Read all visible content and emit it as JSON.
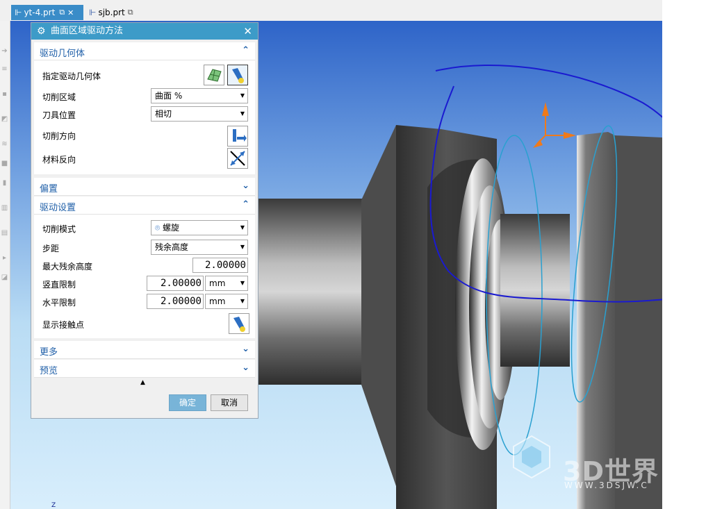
{
  "tabs": [
    {
      "label": "yt-4.prt",
      "active": true
    },
    {
      "label": "sjb.prt",
      "active": false
    }
  ],
  "dialog": {
    "title": "曲面区域驱动方法",
    "sections": {
      "drive_geometry": {
        "title": "驱动几何体",
        "specify_label": "指定驱动几何体",
        "cut_area_label": "切削区域",
        "cut_area_value": "曲面 %",
        "tool_position_label": "刀具位置",
        "tool_position_value": "相切",
        "cut_direction_label": "切削方向",
        "material_reverse_label": "材料反向"
      },
      "offset": {
        "title": "偏置"
      },
      "drive_settings": {
        "title": "驱动设置",
        "cut_pattern_label": "切削模式",
        "cut_pattern_value": "螺旋",
        "stepover_label": "步距",
        "stepover_value": "残余高度",
        "max_scallop_label": "最大残余高度",
        "max_scallop_value": "2.00000",
        "vertical_limit_label": "竖直限制",
        "vertical_limit_value": "2.00000",
        "vertical_limit_unit": "mm",
        "horizontal_limit_label": "水平限制",
        "horizontal_limit_value": "2.00000",
        "horizontal_limit_unit": "mm",
        "show_contact_label": "显示接触点"
      },
      "more": {
        "title": "更多"
      },
      "preview": {
        "title": "预览"
      }
    },
    "ok_label": "确定",
    "cancel_label": "取消"
  },
  "watermark": {
    "text": "3D世界",
    "url": "WWW.3DSJW.C"
  },
  "axis_label": "Z",
  "colors": {
    "title_bar": "#3d9bc8",
    "section_text": "#1f5fa8",
    "ok_button": "#78b4d8",
    "annotation": "#1a1ad0",
    "toolpath": "#2aa0d0",
    "handle": "#f07a1a"
  }
}
